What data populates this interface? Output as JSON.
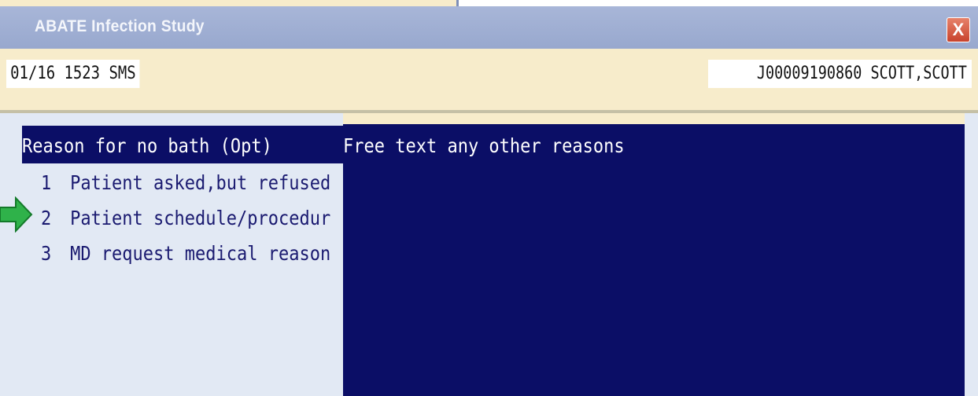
{
  "window": {
    "title": "ABATE Infection Study",
    "close_symbol": "X"
  },
  "header": {
    "datetime": "01/16 1523 SMS",
    "patient_id_name": "J00009190860  SCOTT,SCOTT"
  },
  "list": {
    "header": "Reason for no bath (Opt)",
    "items": [
      {
        "number": "1",
        "label": "Patient asked,but refused"
      },
      {
        "number": "2",
        "label": "Patient schedule/procedur"
      },
      {
        "number": "3",
        "label": "MD request medical reason"
      }
    ],
    "pointer_item": "2"
  },
  "free_text": {
    "header": "Free text any other reasons"
  },
  "colors": {
    "panel_navy": "#0b0e66",
    "list_bg": "#e2e9f4",
    "titlebar": "#a8b6d8",
    "background": "#f7eccb",
    "arrow": "#2fb24a",
    "close": "#d4553d"
  },
  "icons": {
    "pointer": "green-arrow-icon",
    "close": "close-icon"
  }
}
